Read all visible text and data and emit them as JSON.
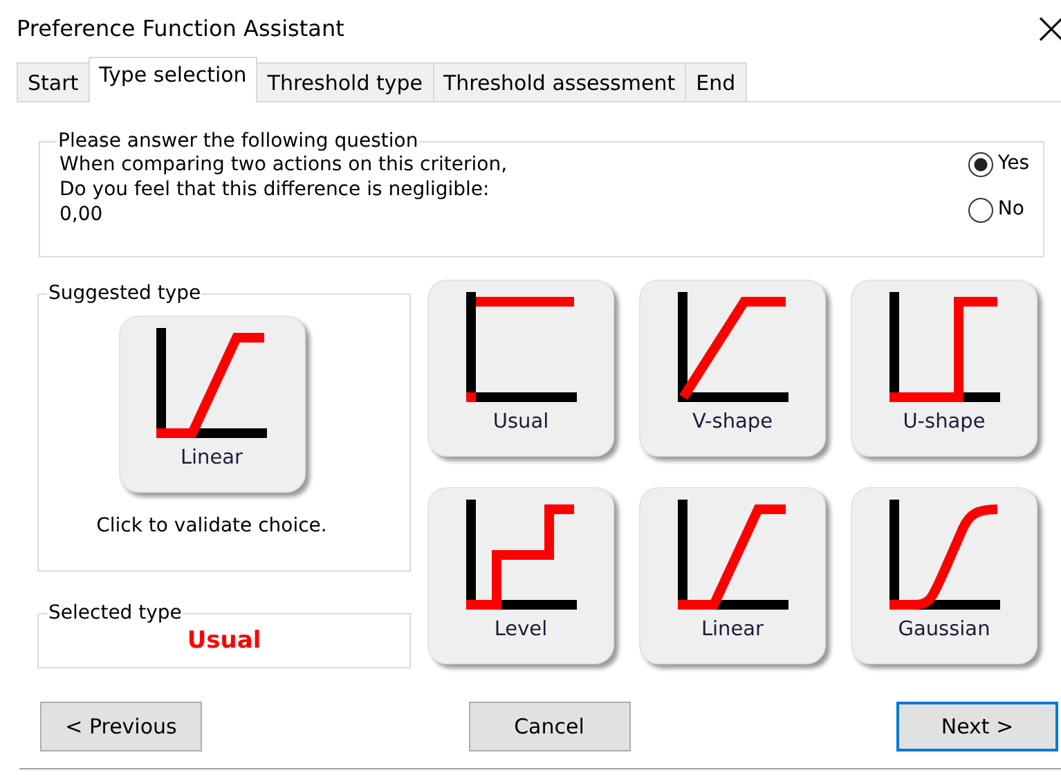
{
  "window": {
    "title": "Preference Function Assistant"
  },
  "tabs": [
    {
      "label": "Start",
      "selected": false
    },
    {
      "label": "Type selection",
      "selected": true
    },
    {
      "label": "Threshold type",
      "selected": false
    },
    {
      "label": "Threshold assessment",
      "selected": false
    },
    {
      "label": "End",
      "selected": false
    }
  ],
  "question": {
    "legend": "Please answer the following question",
    "lines": [
      "When comparing two actions on this criterion,",
      "Do you feel that this difference is negligible:"
    ],
    "value": "0,00",
    "options": [
      {
        "label": "Yes",
        "selected": true
      },
      {
        "label": "No",
        "selected": false
      }
    ]
  },
  "suggested": {
    "legend": "Suggested type",
    "button": {
      "label": "Linear",
      "kind": "linear"
    },
    "hint": "Click to validate choice."
  },
  "selected_type": {
    "legend": "Selected type",
    "value": "Usual"
  },
  "types": [
    {
      "label": "Usual",
      "kind": "usual"
    },
    {
      "label": "V-shape",
      "kind": "vshape"
    },
    {
      "label": "U-shape",
      "kind": "ushape"
    },
    {
      "label": "Level",
      "kind": "level"
    },
    {
      "label": "Linear",
      "kind": "linear"
    },
    {
      "label": "Gaussian",
      "kind": "gaussian"
    }
  ],
  "buttons": [
    {
      "label": "< Previous",
      "default": false
    },
    {
      "label": "Cancel",
      "default": false
    },
    {
      "label": "Next >",
      "default": true
    }
  ]
}
